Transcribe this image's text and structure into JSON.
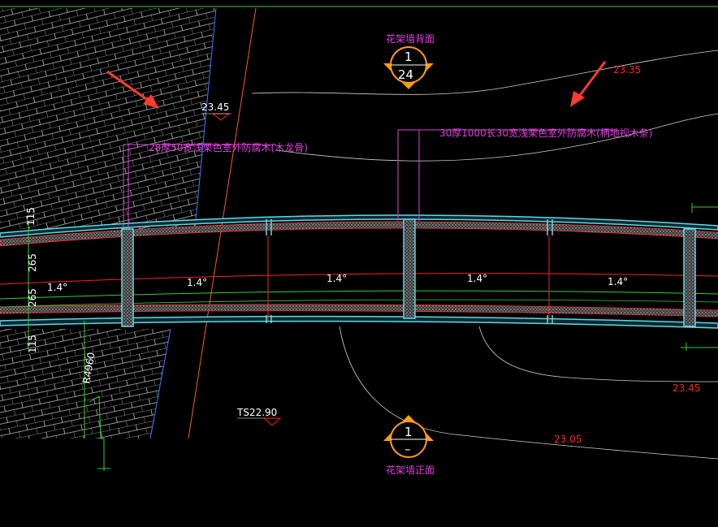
{
  "callouts": {
    "back_view_title": "花架墙背面",
    "back_view_number": "1",
    "back_view_sheet": "24",
    "front_view_title": "花架墙正面",
    "front_view_number": "1",
    "front_view_sheet": "–"
  },
  "elevations": {
    "top_left": "23.45",
    "top_right": "23.35",
    "right_lower": "23.45",
    "bottom_center": "23.05",
    "ts_level": "TS22.90"
  },
  "notes": {
    "wood_left": "28厚50宽浅栗色室外防腐木(木龙骨)",
    "wood_right": "30厚1000长30宽浅栗色室外防腐木(柄地视木条)"
  },
  "dimensions": {
    "dim_115_top": "115",
    "dim_265_a": "265",
    "dim_265_b": "265",
    "dim_115_bottom": "115",
    "radius": "R4960",
    "angle_left": "1.4°",
    "angle_1": "1.4°",
    "angle_2": "1.4°",
    "angle_3": "1.4°",
    "angle_4": "1.4°"
  },
  "colors": {
    "background": "#000000",
    "cyan": "#60d8e8",
    "magenta": "#e040e0",
    "red": "#ff2020",
    "green": "#30d030",
    "orange": "#ff9a1a",
    "white": "#ffffff",
    "arrow": "#ff3b2f"
  }
}
